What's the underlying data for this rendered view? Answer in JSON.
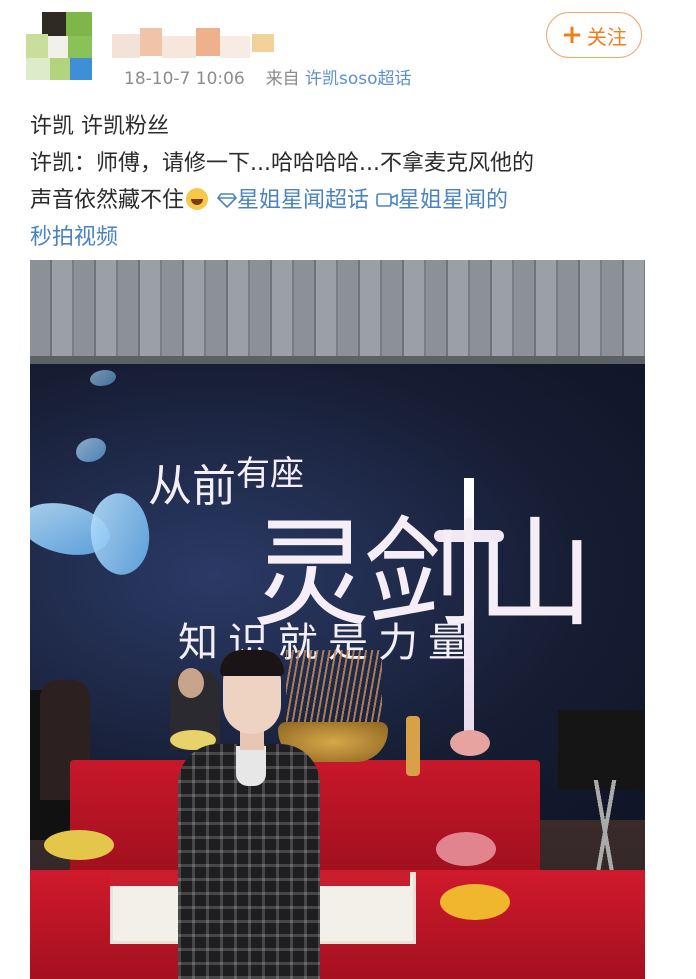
{
  "post": {
    "timestamp": "18-10-7 10:06",
    "source_prefix": "来自",
    "source_name": "许凯soso超话",
    "follow_label": "关注",
    "follow_icon": "plus-icon",
    "text_line1": "许凯 许凯粉丝",
    "text_line2": "许凯：师傅，请修一下...哈哈哈哈...不拿麦克风他的",
    "text_line3_a": "声音依然藏不住",
    "emoji": "laugh-cry-emoji",
    "topic_icon": "diamond-icon",
    "topic_link": "星姐星闻超话",
    "video_icon": "video-link-icon",
    "video_link_a": "星姐星闻的",
    "video_link_b": "秒拍视频"
  },
  "banner": {
    "line1_a": "从前",
    "line1_b": "有座",
    "line2": "灵剑山",
    "line3": "知识就是力量"
  },
  "colors": {
    "accent_orange": "#f07f1a",
    "link_blue": "#4a83c4",
    "meta_gray": "#8c8c8c"
  }
}
